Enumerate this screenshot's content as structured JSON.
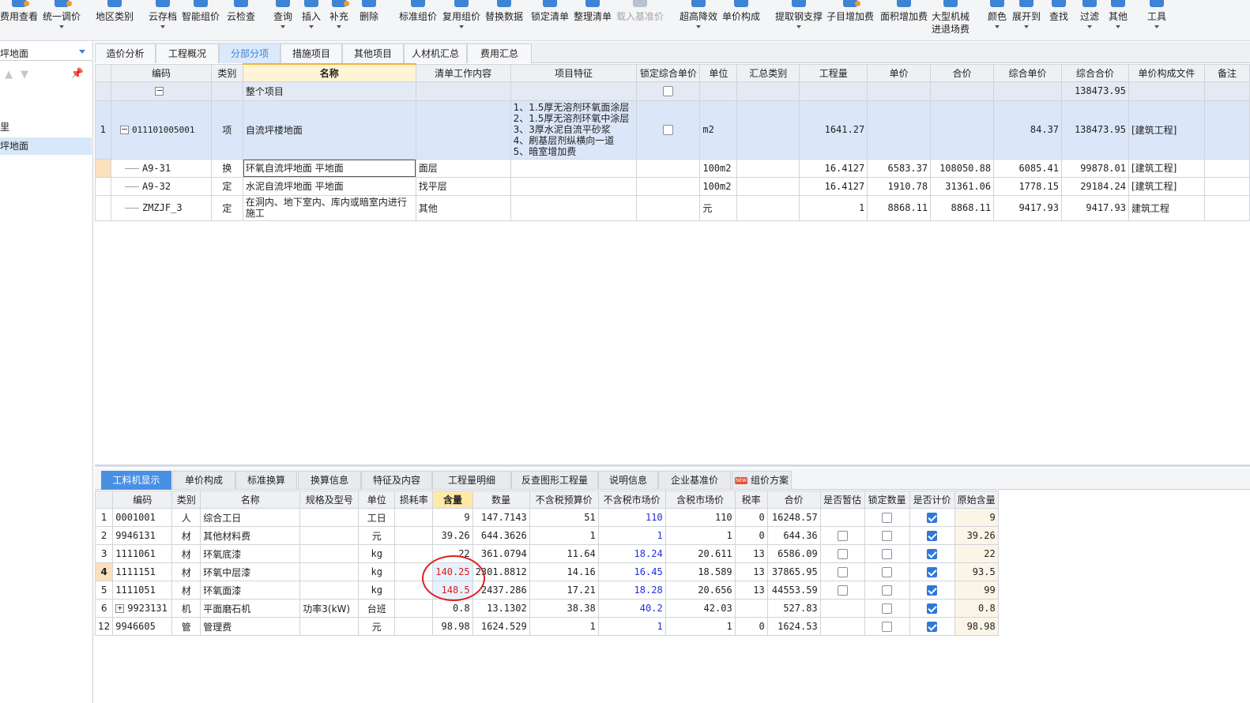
{
  "toolbar": {
    "items": [
      {
        "label": "费用查看"
      },
      {
        "label": "统一调价"
      },
      {
        "label": "地区类别"
      },
      {
        "label": "云存档"
      },
      {
        "label": "智能组价"
      },
      {
        "label": "云检查"
      },
      {
        "label": "查询"
      },
      {
        "label": "插入"
      },
      {
        "label": "补充"
      },
      {
        "label": "删除"
      },
      {
        "label": "标准组价"
      },
      {
        "label": "复用组价"
      },
      {
        "label": "替换数据"
      },
      {
        "label": "锁定清单"
      },
      {
        "label": "整理清单"
      },
      {
        "label": "载入基准价"
      },
      {
        "label": "超高降效"
      },
      {
        "label": "单价构成"
      },
      {
        "label": "提取钢支撑"
      },
      {
        "label": "子目增加费"
      },
      {
        "label": "面积增加费"
      },
      {
        "label": "大型机械"
      },
      {
        "label": "颜色"
      },
      {
        "label": "展开到"
      },
      {
        "label": "查找"
      },
      {
        "label": "过滤"
      },
      {
        "label": "其他"
      },
      {
        "label": "工具"
      }
    ],
    "item21_line2": "进退场费"
  },
  "left": {
    "select_value": "坪地面",
    "tree_item_1": "里",
    "tree_item_2": "坪地面"
  },
  "tabs": [
    "造价分析",
    "工程概况",
    "分部分项",
    "措施项目",
    "其他项目",
    "人材机汇总",
    "费用汇总"
  ],
  "main": {
    "headers": [
      "编码",
      "类别",
      "名称",
      "清单工作内容",
      "项目特征",
      "锁定综合单价",
      "单位",
      "汇总类别",
      "工程量",
      "单价",
      "合价",
      "综合单价",
      "综合合价",
      "单价构成文件",
      "备注"
    ],
    "whole": {
      "name": "整个项目",
      "total": "138473.95"
    },
    "item": {
      "no": "1",
      "code": "011101005001",
      "type": "项",
      "name": "自流坪楼地面",
      "features": [
        "1、1.5厚无溶剂环氧面涂层",
        "2、1.5厚无溶剂环氧中涂层",
        "3、3厚水泥自流平砂浆",
        "4、刷基层剂纵横向一道",
        "5、暗室增加费"
      ],
      "unit": "m2",
      "qty": "1641.27",
      "comp_price": "84.37",
      "comp_total": "138473.95",
      "file": "[建筑工程]"
    },
    "subs": [
      {
        "code": "A9-31",
        "type": "换",
        "name": "环氧自流坪地面 平地面",
        "work": "面层",
        "unit": "100m2",
        "qty": "16.4127",
        "price": "6583.37",
        "total": "108050.88",
        "comp_price": "6085.41",
        "comp_total": "99878.01",
        "file": "[建筑工程]"
      },
      {
        "code": "A9-32",
        "type": "定",
        "name": "水泥自流坪地面 平地面",
        "work": "找平层",
        "unit": "100m2",
        "qty": "16.4127",
        "price": "1910.78",
        "total": "31361.06",
        "comp_price": "1778.15",
        "comp_total": "29184.24",
        "file": "[建筑工程]"
      },
      {
        "code": "ZMZJF_3",
        "type": "定",
        "name": "在洞内、地下室内、库内或暗室内进行施工",
        "work": "其他",
        "unit": "元",
        "qty": "1",
        "price": "8868.11",
        "total": "8868.11",
        "comp_price": "9417.93",
        "comp_total": "9417.93",
        "file": "建筑工程"
      }
    ]
  },
  "bottom_tabs": [
    "工料机显示",
    "单价构成",
    "标准换算",
    "换算信息",
    "特征及内容",
    "工程量明细",
    "反查图形工程量",
    "说明信息",
    "企业基准价",
    "组价方案"
  ],
  "new_badge": "NEW",
  "resources": {
    "headers": [
      "编码",
      "类别",
      "名称",
      "规格及型号",
      "单位",
      "损耗率",
      "含量",
      "数量",
      "不含税预算价",
      "不含税市场价",
      "含税市场价",
      "税率",
      "合价",
      "是否暂估",
      "锁定数量",
      "是否计价",
      "原始含量"
    ],
    "rows": [
      {
        "no": "1",
        "code": "0001001",
        "type": "人",
        "name": "综合工日",
        "spec": "",
        "unit": "工日",
        "loss": "",
        "content": "9",
        "qty": "147.7143",
        "budget": "51",
        "market": "110",
        "tax_market": "110",
        "tax_rate": "0",
        "total": "16248.57",
        "est": "",
        "lock": false,
        "priced": true,
        "orig": "9"
      },
      {
        "no": "2",
        "code": "9946131",
        "type": "材",
        "name": "其他材料费",
        "spec": "",
        "unit": "元",
        "loss": "",
        "content": "39.26",
        "qty": "644.3626",
        "budget": "1",
        "market": "1",
        "tax_market": "1",
        "tax_rate": "0",
        "total": "644.36",
        "est": false,
        "lock": false,
        "priced": true,
        "orig": "39.26"
      },
      {
        "no": "3",
        "code": "1111061",
        "type": "材",
        "name": "环氧底漆",
        "spec": "",
        "unit": "kg",
        "loss": "",
        "content": "22",
        "qty": "361.0794",
        "budget": "11.64",
        "market": "18.24",
        "tax_market": "20.611",
        "tax_rate": "13",
        "total": "6586.09",
        "est": false,
        "lock": false,
        "priced": true,
        "orig": "22"
      },
      {
        "no": "4",
        "code": "1111151",
        "type": "材",
        "name": "环氧中层漆",
        "spec": "",
        "unit": "kg",
        "loss": "",
        "content": "140.25",
        "qty": "2301.8812",
        "budget": "14.16",
        "market": "16.45",
        "tax_market": "18.589",
        "tax_rate": "13",
        "total": "37865.95",
        "est": false,
        "lock": false,
        "priced": true,
        "orig": "93.5"
      },
      {
        "no": "5",
        "code": "1111051",
        "type": "材",
        "name": "环氧面漆",
        "spec": "",
        "unit": "kg",
        "loss": "",
        "content": "148.5",
        "qty": "2437.286",
        "budget": "17.21",
        "market": "18.28",
        "tax_market": "20.656",
        "tax_rate": "13",
        "total": "44553.59",
        "est": false,
        "lock": false,
        "priced": true,
        "orig": "99"
      },
      {
        "no": "6",
        "code": "9923131",
        "type": "机",
        "name": "平面磨石机",
        "spec": "功率3(kW)",
        "unit": "台班",
        "loss": "",
        "content": "0.8",
        "qty": "13.1302",
        "budget": "38.38",
        "market": "40.2",
        "tax_market": "42.03",
        "tax_rate": "",
        "total": "527.83",
        "est": "",
        "lock": false,
        "priced": true,
        "orig": "0.8"
      },
      {
        "no": "12",
        "code": "9946605",
        "type": "管",
        "name": "管理费",
        "spec": "",
        "unit": "元",
        "loss": "",
        "content": "98.98",
        "qty": "1624.529",
        "budget": "1",
        "market": "1",
        "tax_market": "1",
        "tax_rate": "0",
        "total": "1624.53",
        "est": "",
        "lock": false,
        "priced": true,
        "orig": "98.98"
      }
    ]
  },
  "colors": {
    "accent": "#3d84d6",
    "highlight_red": "#e21b1b",
    "market_blue": "#1f2fd6"
  }
}
